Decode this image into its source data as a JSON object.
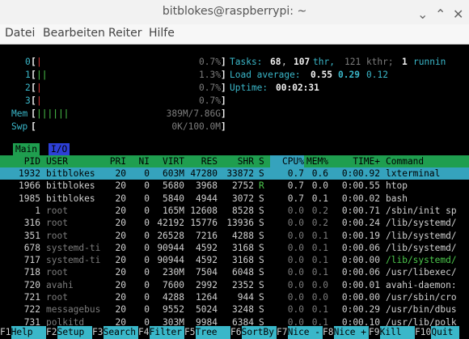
{
  "window": {
    "title": "bitblokes@raspberrypi: ~",
    "minimize": "⌄",
    "maximize": "⌃",
    "close": "✕"
  },
  "menu": [
    "Datei",
    "Bearbeiten",
    "Reiter",
    "Hilfe"
  ],
  "meters": {
    "cpus": [
      {
        "label": "0",
        "bar": "|",
        "value": "0.7%"
      },
      {
        "label": "1",
        "bar": "||",
        "value": "1.3%"
      },
      {
        "label": "2",
        "bar": "|",
        "value": "0.7%"
      },
      {
        "label": "3",
        "bar": "|",
        "value": "0.7%"
      }
    ],
    "mem": {
      "label": "Mem",
      "bar": "||||||",
      "value": "389M/7.86G"
    },
    "swp": {
      "label": "Swp",
      "bar": "",
      "value": "0K/100.0M"
    }
  },
  "summary": {
    "tasks_label": "Tasks:",
    "tasks": "68",
    "thr": "107",
    "thr_label": "thr,",
    "kthr": "121 kthr;",
    "running": "1",
    "running_label": "runnin",
    "load_label": "Load average:",
    "load1": "0.55",
    "load5": "0.29",
    "load15": "0.12",
    "uptime_label": "Uptime:",
    "uptime": "00:02:31"
  },
  "tabs": {
    "main": "Main",
    "io": "I/O"
  },
  "columns": {
    "pid": "PID",
    "user": "USER",
    "pri": "PRI",
    "ni": "NI",
    "virt": "VIRT",
    "res": "RES",
    "shr": "SHR",
    "s": "S",
    "cpu": "CPU%",
    "mem": "MEM%",
    "time": "TIME+",
    "command": "Command"
  },
  "processes": [
    {
      "pid": "1932",
      "user": "bitblokes",
      "pri": "20",
      "ni": "0",
      "virt": "603M",
      "res": "47280",
      "shr": "33872",
      "s": "S",
      "cpu": "0.7",
      "mem": "0.6",
      "time": "0:00.92",
      "command": "lxterminal"
    },
    {
      "pid": "1966",
      "user": "bitblokes",
      "pri": "20",
      "ni": "0",
      "virt": "5680",
      "res": "3968",
      "shr": "2752",
      "s": "R",
      "cpu": "0.7",
      "mem": "0.0",
      "time": "0:00.55",
      "command": "htop"
    },
    {
      "pid": "1985",
      "user": "bitblokes",
      "pri": "20",
      "ni": "0",
      "virt": "5840",
      "res": "4944",
      "shr": "3072",
      "s": "S",
      "cpu": "0.7",
      "mem": "0.1",
      "time": "0:00.02",
      "command": "bash"
    },
    {
      "pid": "1",
      "user": "root",
      "pri": "20",
      "ni": "0",
      "virt": "165M",
      "res": "12608",
      "shr": "8528",
      "s": "S",
      "cpu": "0.0",
      "mem": "0.2",
      "time": "0:00.71",
      "command": "/sbin/init sp"
    },
    {
      "pid": "316",
      "user": "root",
      "pri": "20",
      "ni": "0",
      "virt": "42192",
      "res": "15776",
      "shr": "13936",
      "s": "S",
      "cpu": "0.0",
      "mem": "0.2",
      "time": "0:00.24",
      "command": "/lib/systemd/"
    },
    {
      "pid": "351",
      "user": "root",
      "pri": "20",
      "ni": "0",
      "virt": "26528",
      "res": "7216",
      "shr": "4288",
      "s": "S",
      "cpu": "0.0",
      "mem": "0.1",
      "time": "0:00.19",
      "command": "/lib/systemd/"
    },
    {
      "pid": "678",
      "user": "systemd-ti",
      "pri": "20",
      "ni": "0",
      "virt": "90944",
      "res": "4592",
      "shr": "3168",
      "s": "S",
      "cpu": "0.0",
      "mem": "0.1",
      "time": "0:00.06",
      "command": "/lib/systemd/"
    },
    {
      "pid": "717",
      "user": "systemd-ti",
      "pri": "20",
      "ni": "0",
      "virt": "90944",
      "res": "4592",
      "shr": "3168",
      "s": "S",
      "cpu": "0.0",
      "mem": "0.1",
      "time": "0:00.00",
      "command": "/lib/systemd/"
    },
    {
      "pid": "718",
      "user": "root",
      "pri": "20",
      "ni": "0",
      "virt": "230M",
      "res": "7504",
      "shr": "6048",
      "s": "S",
      "cpu": "0.0",
      "mem": "0.1",
      "time": "0:00.06",
      "command": "/usr/libexec/"
    },
    {
      "pid": "720",
      "user": "avahi",
      "pri": "20",
      "ni": "0",
      "virt": "7600",
      "res": "2992",
      "shr": "2352",
      "s": "S",
      "cpu": "0.0",
      "mem": "0.0",
      "time": "0:00.01",
      "command": "avahi-daemon:"
    },
    {
      "pid": "721",
      "user": "root",
      "pri": "20",
      "ni": "0",
      "virt": "4288",
      "res": "1264",
      "shr": "944",
      "s": "S",
      "cpu": "0.0",
      "mem": "0.0",
      "time": "0:00.00",
      "command": "/usr/sbin/cro"
    },
    {
      "pid": "722",
      "user": "messagebus",
      "pri": "20",
      "ni": "0",
      "virt": "9552",
      "res": "5024",
      "shr": "3248",
      "s": "S",
      "cpu": "0.0",
      "mem": "0.1",
      "time": "0:00.29",
      "command": "/usr/bin/dbus"
    },
    {
      "pid": "731",
      "user": "polkitd",
      "pri": "20",
      "ni": "0",
      "virt": "303M",
      "res": "9984",
      "shr": "6384",
      "s": "S",
      "cpu": "0.0",
      "mem": "0.1",
      "time": "0:00.10",
      "command": "/usr/lib/polk"
    }
  ],
  "fkeys": [
    {
      "key": "F1",
      "label": "Help"
    },
    {
      "key": "F2",
      "label": "Setup"
    },
    {
      "key": "F3",
      "label": "Search"
    },
    {
      "key": "F4",
      "label": "Filter"
    },
    {
      "key": "F5",
      "label": "Tree"
    },
    {
      "key": "F6",
      "label": "SortBy"
    },
    {
      "key": "F7",
      "label": "Nice -"
    },
    {
      "key": "F8",
      "label": "Nice +"
    },
    {
      "key": "F9",
      "label": "Kill"
    },
    {
      "key": "F10",
      "label": "Quit"
    }
  ],
  "colors": {
    "header_bg": "#1f9e4f",
    "selected_bg": "#35a3bd",
    "accent_cyan": "#3ab7c9",
    "terminal_bg": "#000000"
  }
}
